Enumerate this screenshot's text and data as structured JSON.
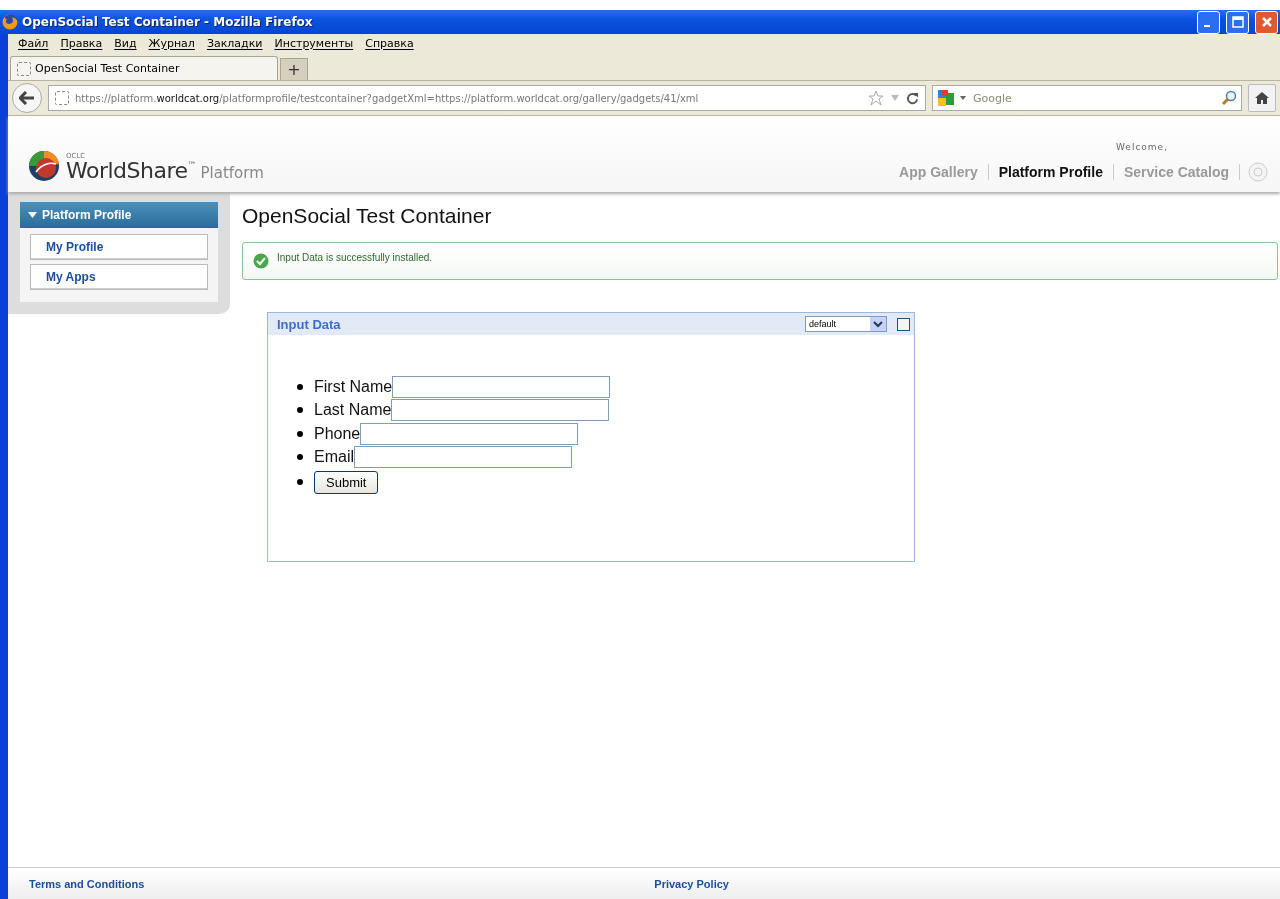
{
  "window": {
    "title": "OpenSocial Test Container - Mozilla Firefox"
  },
  "menu": [
    "Файл",
    "Правка",
    "Вид",
    "Журнал",
    "Закладки",
    "Инструменты",
    "Справка"
  ],
  "tabs": [
    {
      "label": "OpenSocial Test Container",
      "selected": true
    }
  ],
  "new_tab": "+",
  "address": {
    "prefix": "https://platform.",
    "host": "worldcat.org",
    "path": "/platformprofile/testcontainer?gadgetXml=https://platform.worldcat.org/gallery/gadgets/41/xml"
  },
  "search": {
    "placeholder": "Google"
  },
  "header": {
    "logo_small": "OCLC",
    "logo_main": "WorldShare",
    "logo_tm": "™",
    "logo_sub": "Platform",
    "welcome": "Welcome,",
    "nav": [
      {
        "label": "App Gallery",
        "selected": false
      },
      {
        "label": "Platform Profile",
        "selected": true
      },
      {
        "label": "Service Catalog",
        "selected": false
      }
    ]
  },
  "sidebar": {
    "title": "Platform Profile",
    "expanded": true,
    "items": [
      "My Profile",
      "My Apps"
    ]
  },
  "page_title": "OpenSocial Test Container",
  "alert": {
    "message": "Input Data is successfully installed."
  },
  "gadget": {
    "title": "Input Data",
    "view": "default",
    "checked": false,
    "fields": [
      {
        "kind": "text",
        "label": "First Name"
      },
      {
        "kind": "text",
        "label": "Last Name"
      },
      {
        "kind": "text",
        "label": "Phone"
      },
      {
        "kind": "text",
        "label": "Email"
      },
      {
        "kind": "button",
        "label": "Submit"
      }
    ]
  },
  "footer": {
    "links": [
      "Terms and Conditions",
      "Privacy Policy"
    ]
  }
}
